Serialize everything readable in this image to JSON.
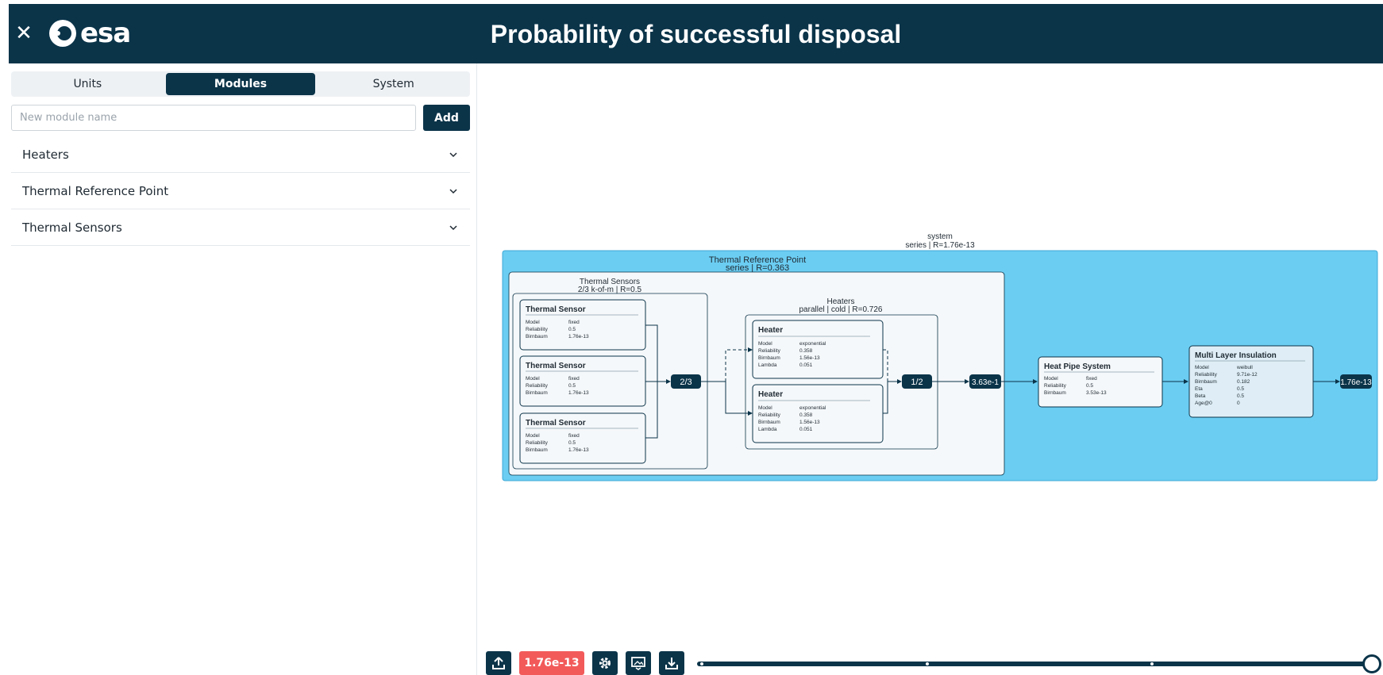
{
  "header": {
    "title": "Probability of successful disposal",
    "logo_text": "esa",
    "close_icon": "close-icon"
  },
  "tabs": [
    {
      "label": "Units",
      "active": false
    },
    {
      "label": "Modules",
      "active": true
    },
    {
      "label": "System",
      "active": false
    }
  ],
  "new_module": {
    "placeholder": "New module name",
    "value": "",
    "add_label": "Add"
  },
  "modules": [
    {
      "label": "Heaters"
    },
    {
      "label": "Thermal Reference Point"
    },
    {
      "label": "Thermal Sensors"
    }
  ],
  "diagram": {
    "system": {
      "title": "system",
      "subtitle": "series | R=1.76e-13"
    },
    "trp": {
      "title": "Thermal Reference Point",
      "subtitle": "series | R=0.363"
    },
    "sensors_group": {
      "title": "Thermal Sensors",
      "subtitle": "2/3 k-of-m | R=0.5"
    },
    "heaters_group": {
      "title": "Heaters",
      "subtitle": "parallel | cold | R=0.726"
    },
    "sensors": [
      {
        "name": "Thermal Sensor",
        "rows": [
          [
            "Model",
            "fixed"
          ],
          [
            "Reliability",
            "0.5"
          ],
          [
            "Birnbaum",
            "1.76e-13"
          ]
        ]
      },
      {
        "name": "Thermal Sensor",
        "rows": [
          [
            "Model",
            "fixed"
          ],
          [
            "Reliability",
            "0.5"
          ],
          [
            "Birnbaum",
            "1.76e-13"
          ]
        ]
      },
      {
        "name": "Thermal Sensor",
        "rows": [
          [
            "Model",
            "fixed"
          ],
          [
            "Reliability",
            "0.5"
          ],
          [
            "Birnbaum",
            "1.76e-13"
          ]
        ]
      }
    ],
    "heaters": [
      {
        "name": "Heater",
        "rows": [
          [
            "Model",
            "exponential"
          ],
          [
            "Reliability",
            "0.358"
          ],
          [
            "Birnbaum",
            "1.56e-13"
          ],
          [
            "Lambda",
            "0.051"
          ]
        ]
      },
      {
        "name": "Heater",
        "rows": [
          [
            "Model",
            "exponential"
          ],
          [
            "Reliability",
            "0.358"
          ],
          [
            "Birnbaum",
            "1.56e-13"
          ],
          [
            "Lambda",
            "0.051"
          ]
        ]
      }
    ],
    "heat_pipe": {
      "name": "Heat Pipe System",
      "rows": [
        [
          "Model",
          "fixed"
        ],
        [
          "Reliability",
          "0.5"
        ],
        [
          "Birnbaum",
          "3.53e-13"
        ]
      ]
    },
    "mli": {
      "name": "Multi Layer Insulation",
      "rows": [
        [
          "Model",
          "weibull"
        ],
        [
          "Reliability",
          "9.71e-12"
        ],
        [
          "Birnbaum",
          "0.182"
        ],
        [
          "Eta",
          "0.5"
        ],
        [
          "Beta",
          "0.5"
        ],
        [
          "Age@0",
          "0"
        ]
      ]
    },
    "nodes": {
      "k_of_m": "2/3",
      "parallel": "1/2",
      "trp_out": "3.63e-1",
      "system_out": "1.76e-13"
    }
  },
  "toolbar": {
    "upload_icon": "upload-icon",
    "result_badge": "1.76e-13",
    "settings_icon": "gear-icon",
    "image_icon": "image-export-icon",
    "download_icon": "download-icon"
  },
  "colors": {
    "primary": "#0b3449",
    "accent": "#6bcdf2",
    "badge": "#f25a5a"
  }
}
